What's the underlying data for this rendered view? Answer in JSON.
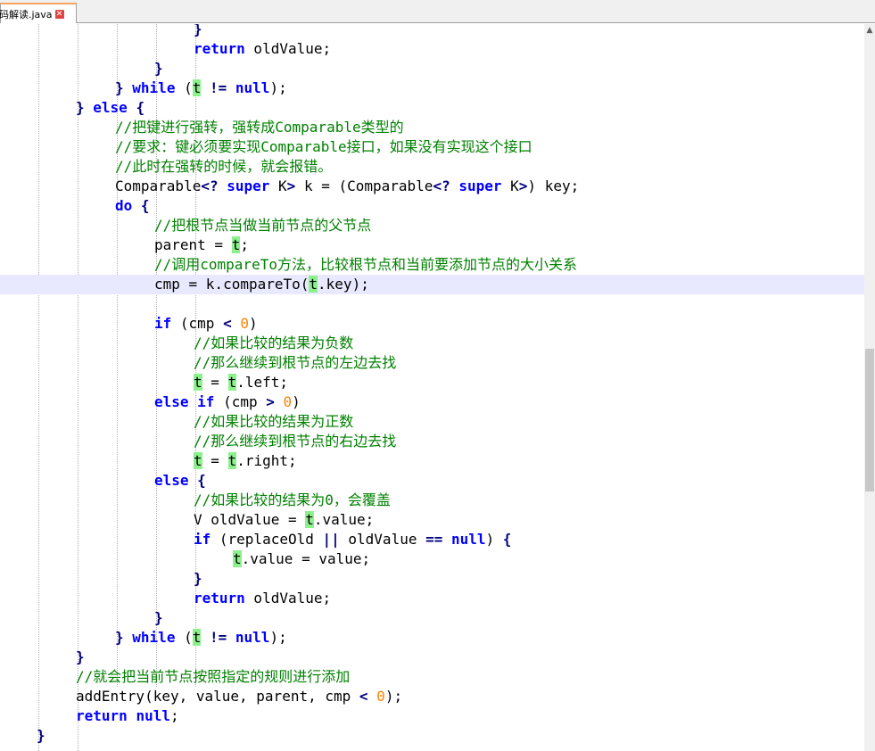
{
  "tab": {
    "label": "码解读.java",
    "close": "✕"
  },
  "scrollbar": {
    "up_arrow": "▲"
  },
  "code_lines": [
    {
      "indent": 5,
      "tokens": [
        {
          "t": "}",
          "c": "op"
        }
      ]
    },
    {
      "indent": 5,
      "tokens": [
        {
          "t": "return",
          "c": "kw"
        },
        {
          "t": " oldValue;"
        }
      ]
    },
    {
      "indent": 4,
      "tokens": [
        {
          "t": "}",
          "c": "op"
        }
      ]
    },
    {
      "indent": 3,
      "tokens": [
        {
          "t": "}",
          "c": "op"
        },
        {
          "t": " "
        },
        {
          "t": "while",
          "c": "kw"
        },
        {
          "t": " ("
        },
        {
          "t": "t",
          "c": "hl"
        },
        {
          "t": " "
        },
        {
          "t": "!=",
          "c": "op"
        },
        {
          "t": " "
        },
        {
          "t": "null",
          "c": "kw"
        },
        {
          "t": ");"
        }
      ]
    },
    {
      "indent": 2,
      "tokens": [
        {
          "t": "}",
          "c": "op"
        },
        {
          "t": " "
        },
        {
          "t": "else",
          "c": "kw"
        },
        {
          "t": " "
        },
        {
          "t": "{",
          "c": "op"
        }
      ]
    },
    {
      "indent": 3,
      "tokens": [
        {
          "t": "//把键进行强转，强转成Comparable类型的",
          "c": "cm"
        }
      ]
    },
    {
      "indent": 3,
      "tokens": [
        {
          "t": "//要求：键必须要实现Comparable接口，如果没有实现这个接口",
          "c": "cm"
        }
      ]
    },
    {
      "indent": 3,
      "tokens": [
        {
          "t": "//此时在强转的时候，就会报错。",
          "c": "cm"
        }
      ]
    },
    {
      "indent": 3,
      "tokens": [
        {
          "t": "Comparable"
        },
        {
          "t": "<?",
          "c": "op"
        },
        {
          "t": " "
        },
        {
          "t": "super",
          "c": "kw"
        },
        {
          "t": " K"
        },
        {
          "t": ">",
          "c": "op"
        },
        {
          "t": " k = (Comparable"
        },
        {
          "t": "<?",
          "c": "op"
        },
        {
          "t": " "
        },
        {
          "t": "super",
          "c": "kw"
        },
        {
          "t": " K"
        },
        {
          "t": ">",
          "c": "op"
        },
        {
          "t": ") key;"
        }
      ]
    },
    {
      "indent": 3,
      "tokens": [
        {
          "t": "do",
          "c": "kw"
        },
        {
          "t": " "
        },
        {
          "t": "{",
          "c": "op"
        }
      ]
    },
    {
      "indent": 4,
      "tokens": [
        {
          "t": "//把根节点当做当前节点的父节点",
          "c": "cm"
        }
      ]
    },
    {
      "indent": 4,
      "tokens": [
        {
          "t": "parent = "
        },
        {
          "t": "t",
          "c": "hl"
        },
        {
          "t": ";"
        }
      ]
    },
    {
      "indent": 4,
      "tokens": [
        {
          "t": "//调用compareTo方法，比较根节点和当前要添加节点的大小关系",
          "c": "cm"
        }
      ]
    },
    {
      "indent": 4,
      "current": true,
      "tokens": [
        {
          "t": "cmp = k.compareTo("
        },
        {
          "t": "t",
          "c": "hl"
        },
        {
          "t": ".key);"
        }
      ]
    },
    {
      "indent": 0,
      "tokens": []
    },
    {
      "indent": 4,
      "tokens": [
        {
          "t": "if",
          "c": "kw"
        },
        {
          "t": " (cmp "
        },
        {
          "t": "<",
          "c": "op"
        },
        {
          "t": " "
        },
        {
          "t": "0",
          "c": "num"
        },
        {
          "t": ")"
        }
      ]
    },
    {
      "indent": 5,
      "tokens": [
        {
          "t": "//如果比较的结果为负数",
          "c": "cm"
        }
      ]
    },
    {
      "indent": 5,
      "tokens": [
        {
          "t": "//那么继续到根节点的左边去找",
          "c": "cm"
        }
      ]
    },
    {
      "indent": 5,
      "tokens": [
        {
          "t": "t",
          "c": "hl"
        },
        {
          "t": " = "
        },
        {
          "t": "t",
          "c": "hl"
        },
        {
          "t": ".left;"
        }
      ]
    },
    {
      "indent": 4,
      "tokens": [
        {
          "t": "else",
          "c": "kw"
        },
        {
          "t": " "
        },
        {
          "t": "if",
          "c": "kw"
        },
        {
          "t": " (cmp "
        },
        {
          "t": ">",
          "c": "op"
        },
        {
          "t": " "
        },
        {
          "t": "0",
          "c": "num"
        },
        {
          "t": ")"
        }
      ]
    },
    {
      "indent": 5,
      "tokens": [
        {
          "t": "//如果比较的结果为正数",
          "c": "cm"
        }
      ]
    },
    {
      "indent": 5,
      "tokens": [
        {
          "t": "//那么继续到根节点的右边去找",
          "c": "cm"
        }
      ]
    },
    {
      "indent": 5,
      "tokens": [
        {
          "t": "t",
          "c": "hl"
        },
        {
          "t": " = "
        },
        {
          "t": "t",
          "c": "hl"
        },
        {
          "t": ".right;"
        }
      ]
    },
    {
      "indent": 4,
      "tokens": [
        {
          "t": "else",
          "c": "kw"
        },
        {
          "t": " "
        },
        {
          "t": "{",
          "c": "op"
        }
      ]
    },
    {
      "indent": 5,
      "tokens": [
        {
          "t": "//如果比较的结果为0，会覆盖",
          "c": "cm"
        }
      ]
    },
    {
      "indent": 5,
      "tokens": [
        {
          "t": "V oldValue = "
        },
        {
          "t": "t",
          "c": "hl"
        },
        {
          "t": ".value;"
        }
      ]
    },
    {
      "indent": 5,
      "tokens": [
        {
          "t": "if",
          "c": "kw"
        },
        {
          "t": " (replaceOld "
        },
        {
          "t": "||",
          "c": "op"
        },
        {
          "t": " oldValue "
        },
        {
          "t": "==",
          "c": "op"
        },
        {
          "t": " "
        },
        {
          "t": "null",
          "c": "kw"
        },
        {
          "t": ") "
        },
        {
          "t": "{",
          "c": "op"
        }
      ]
    },
    {
      "indent": 6,
      "tokens": [
        {
          "t": "t",
          "c": "hl"
        },
        {
          "t": ".value = value;"
        }
      ]
    },
    {
      "indent": 5,
      "tokens": [
        {
          "t": "}",
          "c": "op"
        }
      ]
    },
    {
      "indent": 5,
      "tokens": [
        {
          "t": "return",
          "c": "kw"
        },
        {
          "t": " oldValue;"
        }
      ]
    },
    {
      "indent": 4,
      "tokens": [
        {
          "t": "}",
          "c": "op"
        }
      ]
    },
    {
      "indent": 3,
      "tokens": [
        {
          "t": "}",
          "c": "op"
        },
        {
          "t": " "
        },
        {
          "t": "while",
          "c": "kw"
        },
        {
          "t": " ("
        },
        {
          "t": "t",
          "c": "hl"
        },
        {
          "t": " "
        },
        {
          "t": "!=",
          "c": "op"
        },
        {
          "t": " "
        },
        {
          "t": "null",
          "c": "kw"
        },
        {
          "t": ");"
        }
      ]
    },
    {
      "indent": 2,
      "tokens": [
        {
          "t": "}",
          "c": "op"
        }
      ]
    },
    {
      "indent": 2,
      "tokens": [
        {
          "t": "//就会把当前节点按照指定的规则进行添加",
          "c": "cm"
        }
      ]
    },
    {
      "indent": 2,
      "tokens": [
        {
          "t": "addEntry(key, value, parent, cmp "
        },
        {
          "t": "<",
          "c": "op"
        },
        {
          "t": " "
        },
        {
          "t": "0",
          "c": "num"
        },
        {
          "t": ");"
        }
      ]
    },
    {
      "indent": 2,
      "tokens": [
        {
          "t": "return",
          "c": "kw"
        },
        {
          "t": " "
        },
        {
          "t": "null",
          "c": "kw"
        },
        {
          "t": ";"
        }
      ]
    },
    {
      "indent": 1,
      "tokens": [
        {
          "t": "}",
          "c": "op"
        }
      ]
    }
  ]
}
